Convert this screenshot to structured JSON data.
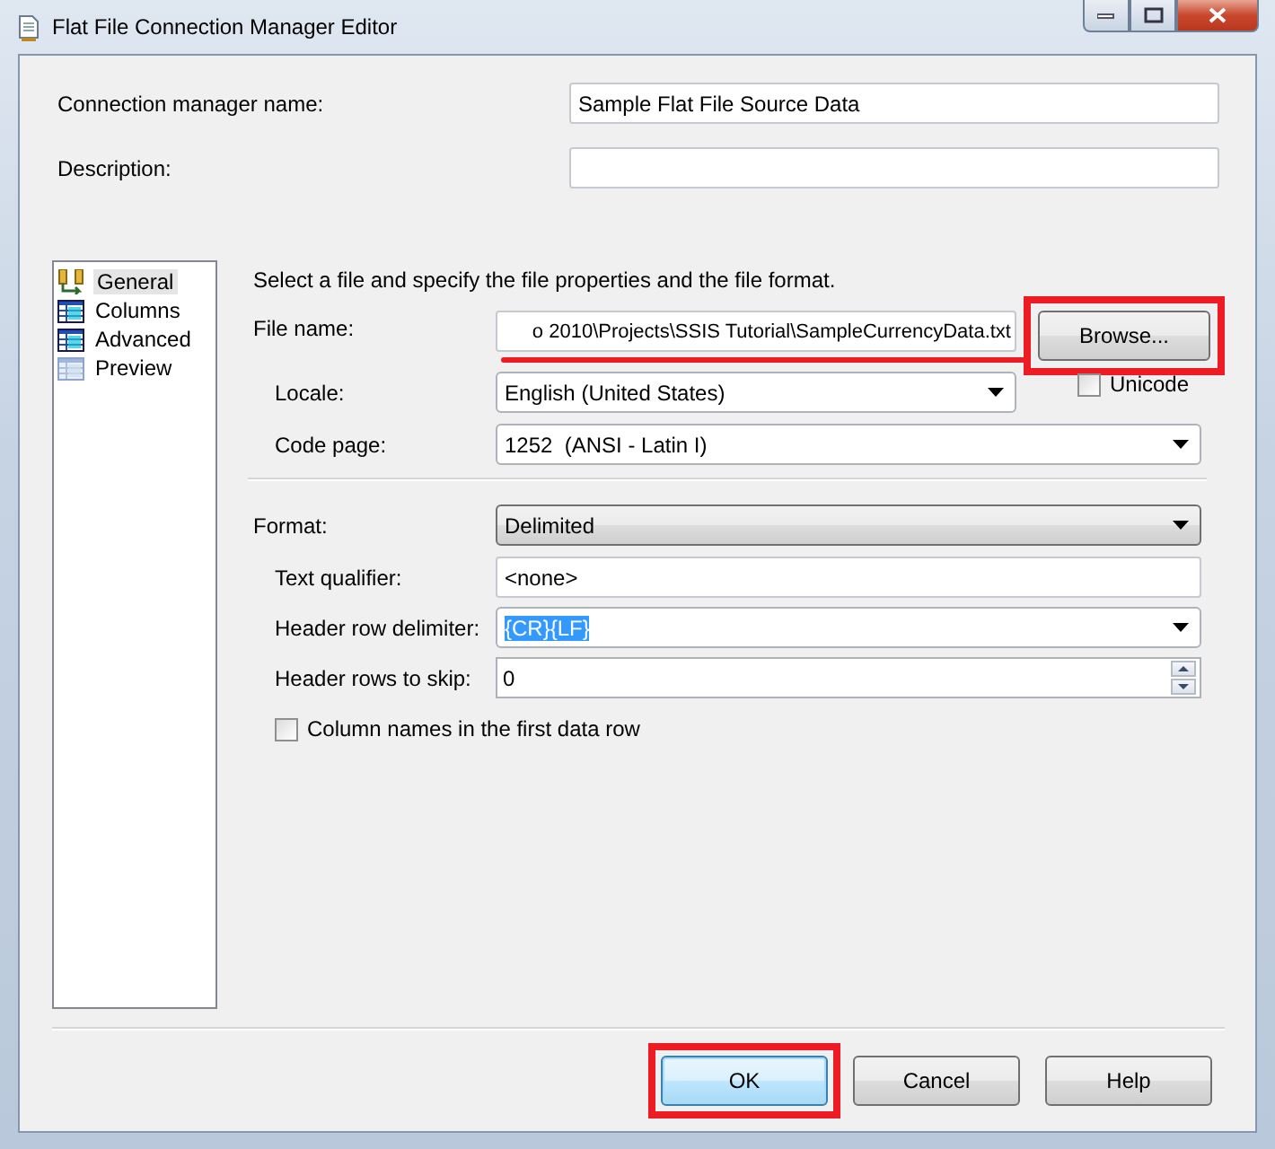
{
  "window": {
    "title": "Flat File Connection Manager Editor"
  },
  "connection_manager_name": {
    "label": "Connection manager name:",
    "value": "Sample Flat File Source Data"
  },
  "description": {
    "label": "Description:"
  },
  "pages": [
    {
      "label": "General",
      "selected": true
    },
    {
      "label": "Columns",
      "selected": false
    },
    {
      "label": "Advanced",
      "selected": false
    },
    {
      "label": "Preview",
      "selected": false
    }
  ],
  "instruction": "Select a file and specify the file properties and the file format.",
  "file_name": {
    "label": "File name:",
    "value": "o 2010\\Projects\\SSIS Tutorial\\SampleCurrencyData.txt",
    "underlined": true
  },
  "browse_button": {
    "label": "Browse...",
    "highlighted": true
  },
  "locale": {
    "label": "Locale:",
    "value": "English (United States)"
  },
  "unicode": {
    "label": "Unicode",
    "checked": false
  },
  "code_page": {
    "label": "Code page:",
    "value": "1252  (ANSI - Latin I)"
  },
  "format": {
    "label": "Format:",
    "value": "Delimited"
  },
  "text_qualifier": {
    "label": "Text qualifier:",
    "value": "<none>"
  },
  "header_row_delimiter": {
    "label": "Header row delimiter:",
    "value": "{CR}{LF}",
    "selected": true
  },
  "header_rows_to_skip": {
    "label": "Header rows to skip:",
    "value": "0"
  },
  "column_names_in_first_row": {
    "label": "Column names in the first data row",
    "checked": false
  },
  "buttons": [
    {
      "label": "OK",
      "highlighted": true
    },
    {
      "label": "Cancel",
      "highlighted": false
    },
    {
      "label": "Help",
      "highlighted": false
    }
  ]
}
